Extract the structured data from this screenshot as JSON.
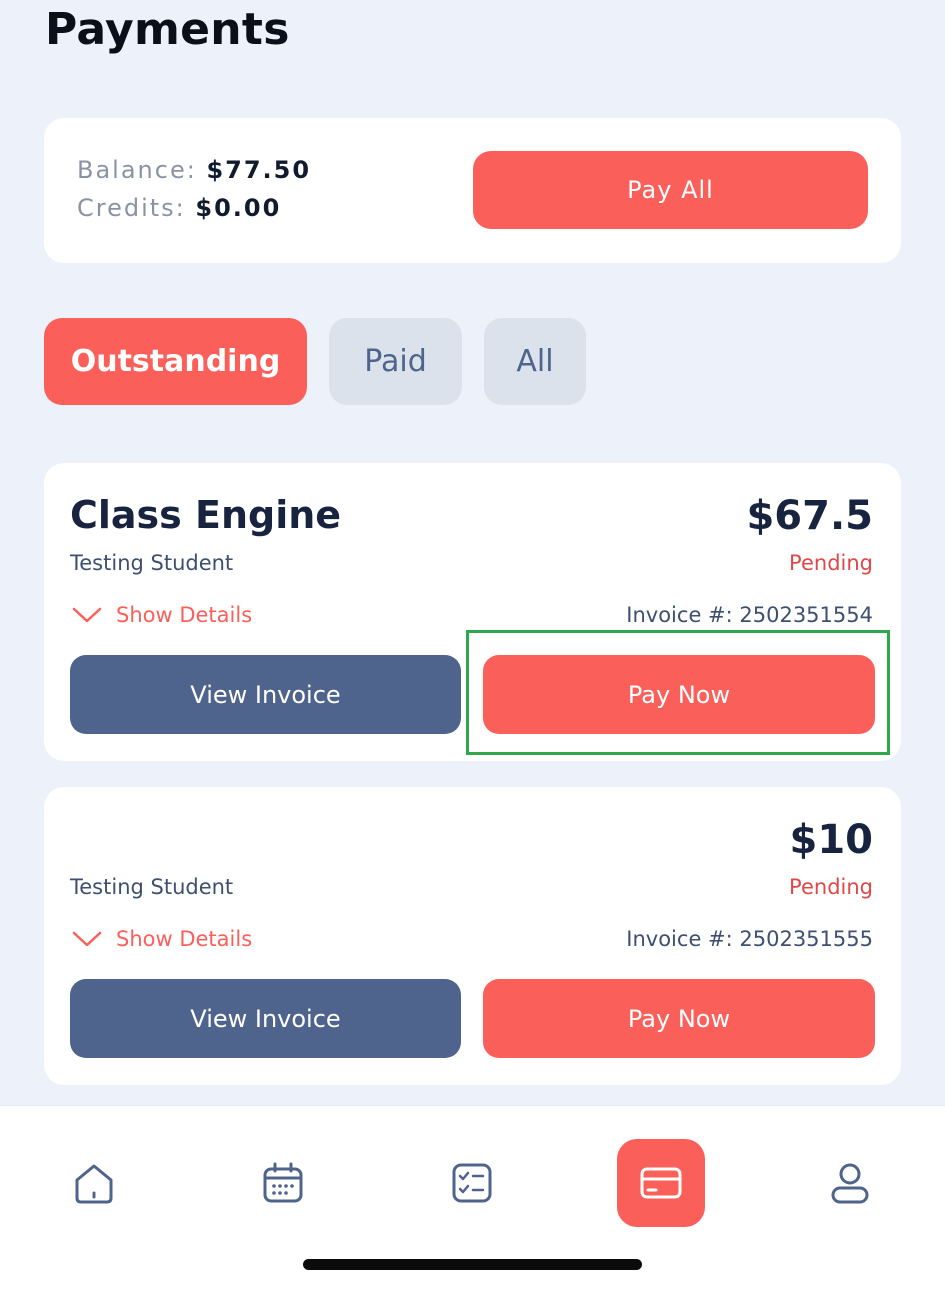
{
  "page": {
    "title": "Payments"
  },
  "summary": {
    "balance_label": "Balance:",
    "balance_value": "$77.50",
    "credits_label": "Credits:",
    "credits_value": "$0.00",
    "pay_all_label": "Pay All"
  },
  "filters": {
    "tabs": [
      {
        "label": "Outstanding",
        "active": true
      },
      {
        "label": "Paid",
        "active": false
      },
      {
        "label": "All",
        "active": false
      }
    ]
  },
  "invoices": [
    {
      "title": "Class Engine",
      "student": "Testing Student",
      "amount": "$67.5",
      "status": "Pending",
      "show_details_label": "Show Details",
      "invoice_number": "Invoice #: 2502351554",
      "view_invoice_label": "View Invoice",
      "pay_now_label": "Pay Now"
    },
    {
      "title": "",
      "student": "Testing Student",
      "amount": "$10",
      "status": "Pending",
      "show_details_label": "Show Details",
      "invoice_number": "Invoice #: 2502351555",
      "view_invoice_label": "View Invoice",
      "pay_now_label": "Pay Now"
    }
  ],
  "bottom_nav": {
    "items": [
      {
        "icon": "home-icon",
        "active": false
      },
      {
        "icon": "calendar-icon",
        "active": false
      },
      {
        "icon": "tasks-icon",
        "active": false
      },
      {
        "icon": "card-icon",
        "active": true
      },
      {
        "icon": "profile-icon",
        "active": false
      }
    ]
  },
  "colors": {
    "background": "#edf1fa",
    "accent": "#fb5f5a",
    "secondary": "#4e648c",
    "status_pending": "#e04848",
    "highlight": "#2ea84a"
  }
}
